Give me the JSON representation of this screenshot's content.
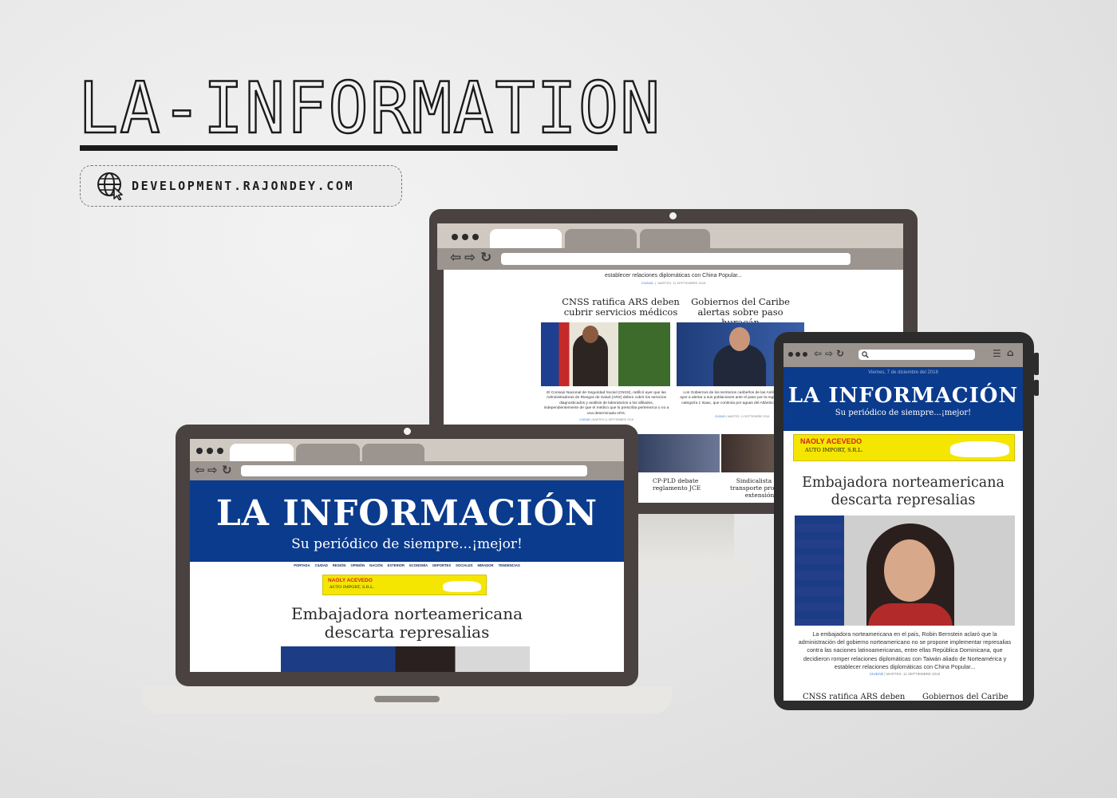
{
  "hero": {
    "title": "LA-INFORMATION",
    "url": "DEVELOPMENT.RAJONDEY.COM",
    "icon": "globe-cursor-icon"
  },
  "colors": {
    "masthead_blue": "#0b3b8c",
    "frame_dark": "#494241",
    "chrome_gray": "#cfc9c2",
    "tab_gray": "#9b948f",
    "ad_yellow": "#f4e600"
  },
  "site": {
    "logo": "LA INFORMACIÓN",
    "tagline": "Su periódico de siempre...¡mejor!",
    "date": "Viernes, 7 de diciembre del 2018",
    "nav": [
      "PORTADA",
      "CIUDAD",
      "REGIÓN",
      "OPINIÓN",
      "NACIÓN",
      "EXTERIOR",
      "ECONOMÍA",
      "DEPORTES",
      "SOCIALES",
      "MIRADOR",
      "TENDENCIAS"
    ],
    "ad": {
      "name": "NAOLY ACEVEDO",
      "company": "AUTO IMPORT, S.R.L."
    },
    "lead_story": {
      "headline": "Embajadora norteamericana descarta represalias",
      "excerpt": "La embajadora norteamericana en el país, Robin Bernstein aclaró que la administración del gobierno norteamericano no se propone implementar represalias contra las naciones latinoamericanas, entre ellas República Dominicana, que decidieron romper relaciones diplomáticas con Taiwán aliado de Norteamérica y establecer relaciones diplomáticas con China Popular...",
      "excerpt_tail": "establecer relaciones diplomáticas con China Popular...",
      "category": "CIUDAD",
      "date": "MARTES, 11 SEPTIEMBRE 2018"
    },
    "stories": [
      {
        "headline": "CNSS ratifica ARS deben cubrir servicios médicos",
        "excerpt": "El Consejo Nacional de Seguridad Social (CNSS), ratificó ayer que las Administradoras de Riesgos de Salud (ARS) deben cubrir los servicios diagnosticados y análisis de laboratorios a los afiliados, independientemente de que el médico que lo prescriba pertenezca o no a una determinada ARS.",
        "category": "CIUDAD",
        "date": "MARTES 11 SEPTIEMBRE 2018"
      },
      {
        "headline": "Gobiernos del Caribe alertas sobre paso huracán",
        "excerpt": "Los Gobiernos de los territorios caribeños de las Antillas comenzaron ayer a alertar a sus poblaciones ante el paso por la región de huracán de categoría 1 Isaac, que continúa por aguas del Atlántico hacia el oeste...",
        "category": "CIUDAD",
        "date": "MARTES, 11 SEPTIEMBRE 2018"
      },
      {
        "headline": "CP-PLD debate reglamento JCE"
      },
      {
        "headline": "Sindicalista del transporte propone extensión"
      }
    ],
    "mobile_cols": [
      "CNSS ratifica ARS deben",
      "Gobiernos del Caribe"
    ]
  }
}
